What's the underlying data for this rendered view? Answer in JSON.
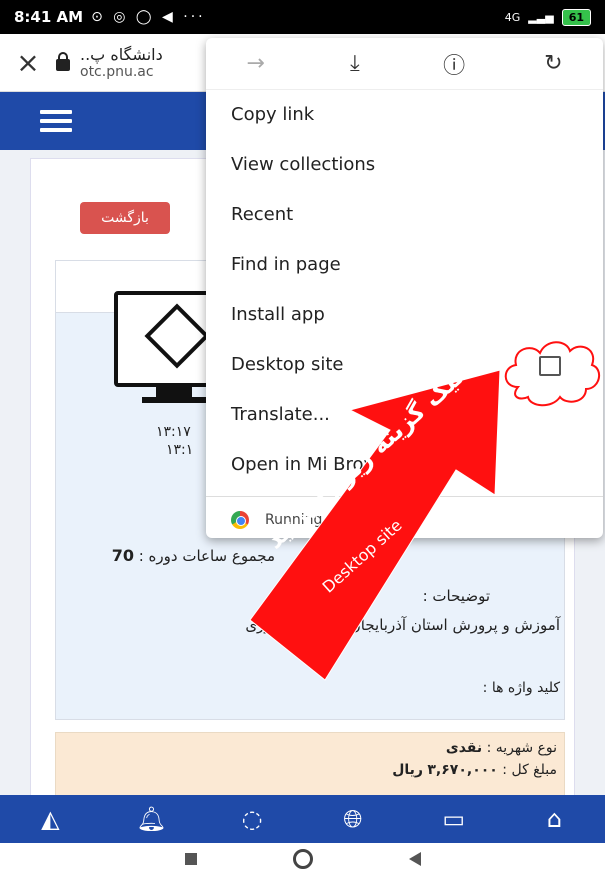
{
  "status_bar": {
    "time": "8:41 AM",
    "icons": "⊙ ◎ ◯ ◀ ···",
    "signal": "4G",
    "battery": "61"
  },
  "browser": {
    "page_title": "دانشگاه پ..",
    "url": "otc.pnu.ac"
  },
  "menu": {
    "items": [
      "Copy link",
      "View collections",
      "Recent",
      "Find in page",
      "Install app",
      "Desktop site",
      "Translate...",
      "Open in Mi Browser"
    ],
    "footer": "Running in Chrome",
    "desktop_site_checked": false
  },
  "page": {
    "back_button": "بازگشت",
    "times": [
      "۱۳:۱۷",
      "۱۳:۱"
    ],
    "total_label": "مجموع ساعات دوره :",
    "total_value": "70",
    "description_label": "توضیحات :",
    "description_text": "آموزش و پرورش استان آذربایجان شرقی- حضوری",
    "keywords_label": "کلید واژه ها :",
    "fee_type_label": "نوع شهریه :",
    "fee_type_value": "نقدی",
    "fee_total_label": "مبلغ کل :",
    "fee_total_value": "۳,۶۷۰,۰۰۰",
    "fee_currency": "ریال"
  },
  "annotation": {
    "persian": "تیک گزینه زیر را بزنید",
    "english": "Desktop site",
    "color": "#ff1010"
  },
  "bottom_nav": [
    "drive-icon",
    "bell-icon",
    "chat-icon",
    "globe-icon",
    "certificate-icon",
    "home-icon"
  ]
}
